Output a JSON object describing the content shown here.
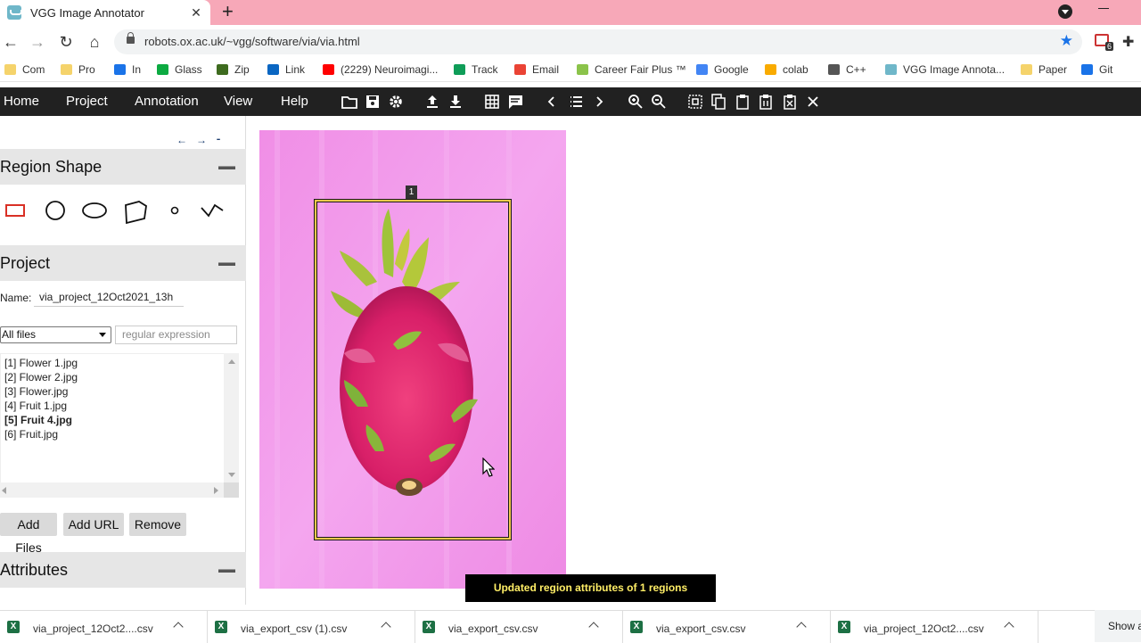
{
  "browser": {
    "tab_title": "VGG Image Annotator",
    "url": "robots.ox.ac.uk/~vgg/software/via/via.html",
    "extension_badge": "6",
    "bookmarks": [
      {
        "label": "Com",
        "icon": "folder-icon",
        "color": "#f5d36b"
      },
      {
        "label": "Pro",
        "icon": "folder-icon",
        "color": "#f5d36b"
      },
      {
        "label": "In",
        "icon": "info-icon",
        "color": "#1a73e8"
      },
      {
        "label": "Glass",
        "icon": "glassdoor-icon",
        "color": "#0caa41"
      },
      {
        "label": "Zip",
        "icon": "ziprecruiter-icon",
        "color": "#3e6b1f"
      },
      {
        "label": "Link",
        "icon": "linkedin-icon",
        "color": "#0a66c2"
      },
      {
        "label": "(2229) Neuroimagi...",
        "icon": "youtube-icon",
        "color": "#ff0000"
      },
      {
        "label": "Track",
        "icon": "track-icon",
        "color": "#0f9d58"
      },
      {
        "label": "Email",
        "icon": "gmail-icon",
        "color": "#ea4335"
      },
      {
        "label": "Career Fair Plus ™",
        "icon": "careerfair-icon",
        "color": "#8bc34a"
      },
      {
        "label": "Google",
        "icon": "google-icon",
        "color": "#4285f4"
      },
      {
        "label": "colab",
        "icon": "colab-icon",
        "color": "#f9ab00"
      },
      {
        "label": "C++",
        "icon": "cpp-icon",
        "color": "#555555"
      },
      {
        "label": "VGG Image Annota...",
        "icon": "via-icon",
        "color": "#6fb7c9"
      },
      {
        "label": "Paper",
        "icon": "folder-icon",
        "color": "#f5d36b"
      },
      {
        "label": "Git",
        "icon": "git-icon",
        "color": "#1a73e8"
      }
    ]
  },
  "menubar": {
    "items": [
      "Home",
      "Project",
      "Annotation",
      "View",
      "Help"
    ]
  },
  "panels": {
    "region_shape": "Region Shape",
    "project": "Project",
    "attributes": "Attributes"
  },
  "project": {
    "name_label": "Name:",
    "name_value": "via_project_12Oct2021_13h",
    "filter_selected": "All files",
    "regex_placeholder": "regular expression",
    "files": [
      {
        "label": "[1] Flower 1.jpg",
        "active": false
      },
      {
        "label": "[2] Flower 2.jpg",
        "active": false
      },
      {
        "label": "[3] Flower.jpg",
        "active": false
      },
      {
        "label": "[4] Fruit 1.jpg",
        "active": false
      },
      {
        "label": "[5] Fruit 4.jpg",
        "active": true
      },
      {
        "label": "[6] Fruit.jpg",
        "active": false
      }
    ],
    "buttons": {
      "add_files": "Add Files",
      "add_url": "Add URL",
      "remove": "Remove"
    }
  },
  "canvas": {
    "region_label": "1",
    "toast": "Updated region attributes of 1 regions"
  },
  "downloads": {
    "items": [
      "via_project_12Oct2....csv",
      "via_export_csv (1).csv",
      "via_export_csv.csv",
      "via_export_csv.csv",
      "via_project_12Oct2....csv"
    ],
    "show_all": "Show all"
  },
  "colors": {
    "menubar_bg": "#212121",
    "tabstrip_bg": "#f7a8b8",
    "region_border": "#f2c94c",
    "toast_text": "#ffee66"
  }
}
